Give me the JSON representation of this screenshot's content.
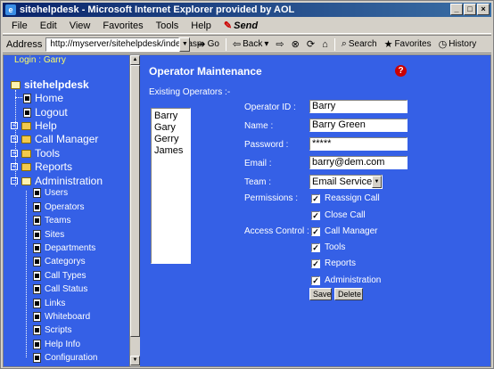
{
  "window": {
    "title": "sitehelpdesk - Microsoft Internet Explorer provided by AOL",
    "buttons": {
      "minimize": "_",
      "maximize": "□",
      "close": "×"
    }
  },
  "menu": {
    "items": [
      "File",
      "Edit",
      "View",
      "Favorites",
      "Tools",
      "Help"
    ],
    "send": "Send"
  },
  "toolbar": {
    "address_label": "Address",
    "address_value": "http://myserver/sitehelpdesk/index.asp",
    "go": "Go",
    "back": "Back",
    "search": "Search",
    "favorites": "Favorites",
    "history": "History"
  },
  "sidebar": {
    "login_label": "Login :",
    "login_user": "Garry",
    "root": "sitehelpdesk",
    "items": [
      {
        "label": "Home",
        "type": "page"
      },
      {
        "label": "Logout",
        "type": "page"
      },
      {
        "label": "Help",
        "type": "folder"
      },
      {
        "label": "Call Manager",
        "type": "folder"
      },
      {
        "label": "Tools",
        "type": "folder"
      },
      {
        "label": "Reports",
        "type": "folder"
      },
      {
        "label": "Administration",
        "type": "folder-open"
      }
    ],
    "admin_items": [
      "Users",
      "Operators",
      "Teams",
      "Sites",
      "Departments",
      "Categorys",
      "Call Types",
      "Call Status",
      "Links",
      "Whiteboard",
      "Scripts",
      "Help Info",
      "Configuration"
    ]
  },
  "main": {
    "title": "Operator Maintenance",
    "help_icon": "?",
    "existing_label": "Existing Operators :-",
    "operators": [
      "Barry",
      "Gary",
      "Gerry",
      "James"
    ],
    "labels": {
      "operator_id": "Operator ID :",
      "name": "Name :",
      "password": "Password :",
      "email": "Email :",
      "team": "Team :",
      "permissions": "Permissions :",
      "access_control": "Access Control :"
    },
    "values": {
      "operator_id": "Barry",
      "name": "Barry Green",
      "password": "*****",
      "email": "barry@dem.com",
      "team": "Email Services"
    },
    "permissions": [
      "Reassign Call",
      "Close Call"
    ],
    "access": [
      "Call Manager",
      "Tools",
      "Reports",
      "Administration"
    ],
    "save": "Save",
    "delete": "Delete"
  }
}
